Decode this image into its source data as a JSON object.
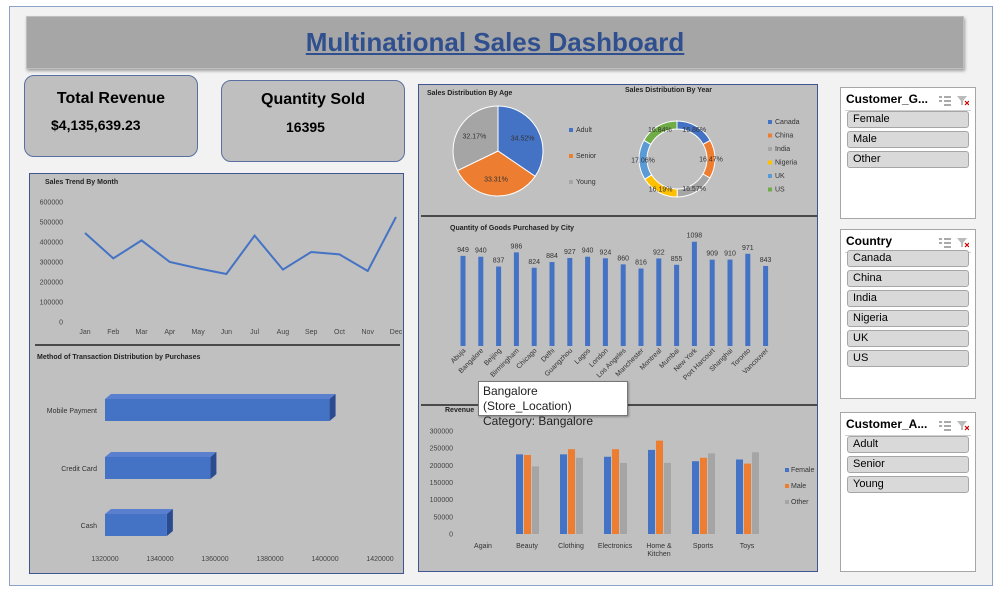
{
  "title": "Multinational Sales Dashboard",
  "kpis": {
    "total_revenue_label": "Total Revenue",
    "total_revenue_value": "$4,135,639.23",
    "quantity_sold_label": "Quantity Sold",
    "quantity_sold_value": "16395"
  },
  "slicers": [
    {
      "header": "Customer_G...",
      "items": [
        "Female",
        "Male",
        "Other"
      ]
    },
    {
      "header": "Country",
      "items": [
        "Canada",
        "China",
        "India",
        "Nigeria",
        "UK",
        "US"
      ]
    },
    {
      "header": "Customer_A...",
      "items": [
        "Adult",
        "Senior",
        "Young"
      ]
    }
  ],
  "tooltip": {
    "line1": "Bangalore (Store_Location)",
    "line2": "Category: Bangalore"
  },
  "colors": {
    "blue": "#4472c4",
    "orange": "#ed7d31",
    "gray": "#a5a5a5",
    "yellow": "#ffc000",
    "lightblue": "#5b9bd5",
    "green": "#70ad47",
    "title": "#2f4f8f"
  },
  "chart_data": [
    {
      "type": "line",
      "title": "Sales Trend By Month",
      "categories": [
        "Jan",
        "Feb",
        "Mar",
        "Apr",
        "May",
        "Jun",
        "Jul",
        "Aug",
        "Sep",
        "Oct",
        "Nov",
        "Dec"
      ],
      "values": [
        445000,
        318000,
        408000,
        300000,
        268000,
        240000,
        432000,
        262000,
        350000,
        338000,
        255000,
        525000
      ],
      "ylim": [
        0,
        600000
      ],
      "yticks": [
        "0",
        "100000",
        "200000",
        "300000",
        "400000",
        "500000",
        "600000"
      ]
    },
    {
      "type": "bar",
      "orientation": "horizontal",
      "title": "Method of Transaction Distribution by Purchases",
      "categories": [
        "Mobile Payment",
        "Credit Card",
        "Cash"
      ],
      "values": [
        1418000,
        1366000,
        1347000
      ],
      "xlim": [
        1320000,
        1440000
      ],
      "xticks": [
        "1320000",
        "1340000",
        "1360000",
        "1380000",
        "1400000",
        "1420000"
      ]
    },
    {
      "type": "pie",
      "title": "Sales Distribution By Age",
      "labels": [
        "Adult",
        "Senior",
        "Young"
      ],
      "values": [
        34.52,
        33.31,
        32.17
      ],
      "value_labels": [
        "34.52%",
        "33.31%",
        "32.17%"
      ]
    },
    {
      "type": "pie",
      "variant": "doughnut",
      "title": "Sales Distribution By Year",
      "labels": [
        "Canada",
        "China",
        "India",
        "Nigeria",
        "UK",
        "US"
      ],
      "values": [
        16.86,
        16.47,
        16.57,
        16.19,
        17.06,
        16.84
      ],
      "value_labels": [
        "16.86%",
        "16.47%",
        "16.57%",
        "16.19%",
        "17.06%",
        "16.84%"
      ]
    },
    {
      "type": "bar",
      "title": "Quantity of Goods Purchased by City",
      "categories": [
        "Abuja",
        "Bangalore",
        "Beijing",
        "Birmingham",
        "Chicago",
        "Delhi",
        "Guangzhou",
        "Lagos",
        "London",
        "Los Angeles",
        "Manchester",
        "Montreal",
        "Mumbai",
        "New York",
        "Port Harcourt",
        "Shanghai",
        "Toronto",
        "Vancouver"
      ],
      "values": [
        949,
        940,
        837,
        986,
        824,
        884,
        927,
        940,
        924,
        860,
        816,
        922,
        855,
        1098,
        909,
        910,
        971,
        843
      ],
      "ylim": [
        0,
        1200
      ]
    },
    {
      "type": "bar",
      "title": "Revenue",
      "categories": [
        "Again",
        "Beauty",
        "Clothing",
        "Electronics",
        "Home & Kitchen",
        "Sports",
        "Toys"
      ],
      "series": [
        {
          "name": "Female",
          "values": [
            0,
            232000,
            232000,
            225000,
            245000,
            212000,
            217000
          ]
        },
        {
          "name": "Male",
          "values": [
            0,
            230000,
            247000,
            247000,
            272000,
            222000,
            205000
          ]
        },
        {
          "name": "Other",
          "values": [
            0,
            197000,
            222000,
            207000,
            207000,
            235000,
            238000
          ]
        }
      ],
      "ylim": [
        0,
        300000
      ],
      "yticks": [
        "0",
        "50000",
        "100000",
        "150000",
        "200000",
        "250000",
        "300000"
      ]
    }
  ]
}
